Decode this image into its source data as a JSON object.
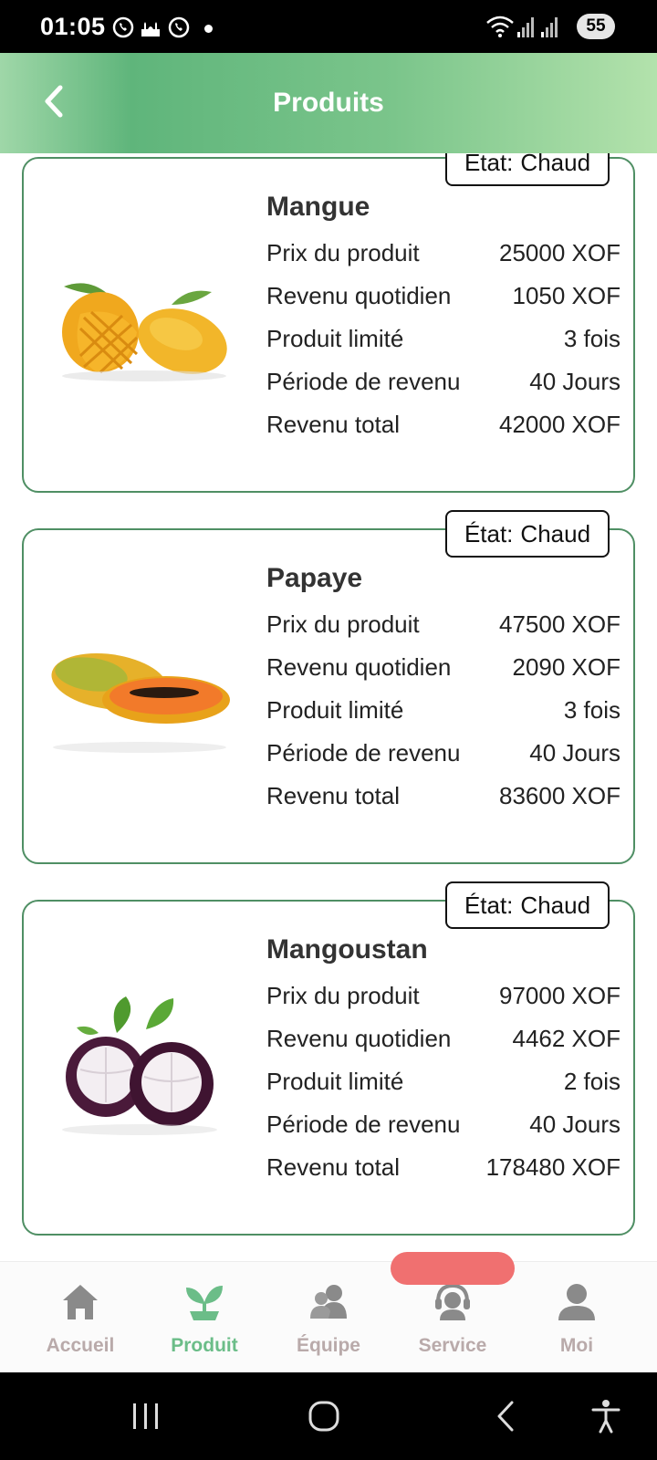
{
  "status_bar": {
    "time": "01:05",
    "battery": "55",
    "notifications": [
      "viber-icon",
      "mosque-icon",
      "viber-icon"
    ]
  },
  "header": {
    "title": "Produits",
    "back_icon": "chevron-left-icon"
  },
  "colors": {
    "accent": "#6bbd88",
    "card_border": "#4f8f64",
    "nav_inactive": "#b9aaaa",
    "service_pill": "#f07070"
  },
  "products": [
    {
      "name": "Mangue",
      "state_label": "État:",
      "state_value": "Chaud",
      "image": "mango-image",
      "rows": [
        {
          "label": "Prix du produit",
          "value": "25000 XOF"
        },
        {
          "label": "Revenu quotidien",
          "value": "1050 XOF"
        },
        {
          "label": "Produit limité",
          "value": "3 fois"
        },
        {
          "label": "Période de revenu",
          "value": "40 Jours"
        },
        {
          "label": "Revenu total",
          "value": "42000 XOF"
        }
      ]
    },
    {
      "name": "Papaye",
      "state_label": "État:",
      "state_value": "Chaud",
      "image": "papaya-image",
      "rows": [
        {
          "label": "Prix du produit",
          "value": "47500 XOF"
        },
        {
          "label": "Revenu quotidien",
          "value": "2090 XOF"
        },
        {
          "label": "Produit limité",
          "value": "3 fois"
        },
        {
          "label": "Période de revenu",
          "value": "40 Jours"
        },
        {
          "label": "Revenu total",
          "value": "83600 XOF"
        }
      ]
    },
    {
      "name": "Mangoustan",
      "state_label": "État:",
      "state_value": "Chaud",
      "image": "mangosteen-image",
      "rows": [
        {
          "label": "Prix du produit",
          "value": "97000 XOF"
        },
        {
          "label": "Revenu quotidien",
          "value": "4462 XOF"
        },
        {
          "label": "Produit limité",
          "value": "2 fois"
        },
        {
          "label": "Période de revenu",
          "value": "40 Jours"
        },
        {
          "label": "Revenu total",
          "value": "178480 XOF"
        }
      ]
    }
  ],
  "bottom_nav": [
    {
      "label": "Accueil",
      "icon": "home-icon",
      "active": false
    },
    {
      "label": "Produit",
      "icon": "sprout-icon",
      "active": true
    },
    {
      "label": "Équipe",
      "icon": "team-icon",
      "active": false
    },
    {
      "label": "Service",
      "icon": "headset-icon",
      "active": false
    },
    {
      "label": "Moi",
      "icon": "user-icon",
      "active": false
    }
  ],
  "system_nav": [
    "recents-icon",
    "home-circle-icon",
    "back-icon",
    "accessibility-icon"
  ]
}
